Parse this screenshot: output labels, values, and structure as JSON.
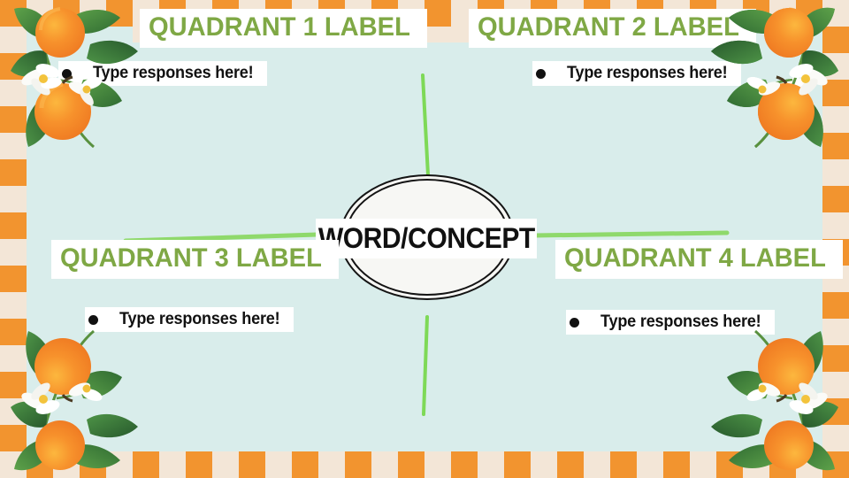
{
  "slide": {
    "type": "concept-map-four-quadrant",
    "background_color": "#d9edeb",
    "frame_colors": {
      "orange": "#f2942f",
      "cream": "#f3e6d7"
    }
  },
  "center": {
    "label": "WORD/CONCEPT",
    "text_color": "#111111",
    "banner_color": "#ffffff",
    "ellipse_fill": "#f7f7f4",
    "ellipse_stroke": "#141414"
  },
  "connector_color": "#7ed957",
  "quadrants": [
    {
      "id": "q1",
      "label": "QUADRANT 1 LABEL",
      "bullet": "Type responses here!"
    },
    {
      "id": "q2",
      "label": "QUADRANT 2 LABEL",
      "bullet": "Type responses here!"
    },
    {
      "id": "q3",
      "label": "QUADRANT 3 LABEL",
      "bullet": "Type responses here!"
    },
    {
      "id": "q4",
      "label": "QUADRANT 4 LABEL",
      "bullet": "Type responses here!"
    }
  ],
  "label_color": "#7fa845",
  "decorations": {
    "corner_motif": "orange-branch-illustration",
    "positions": [
      "top-left",
      "top-right",
      "bottom-left",
      "bottom-right"
    ]
  }
}
